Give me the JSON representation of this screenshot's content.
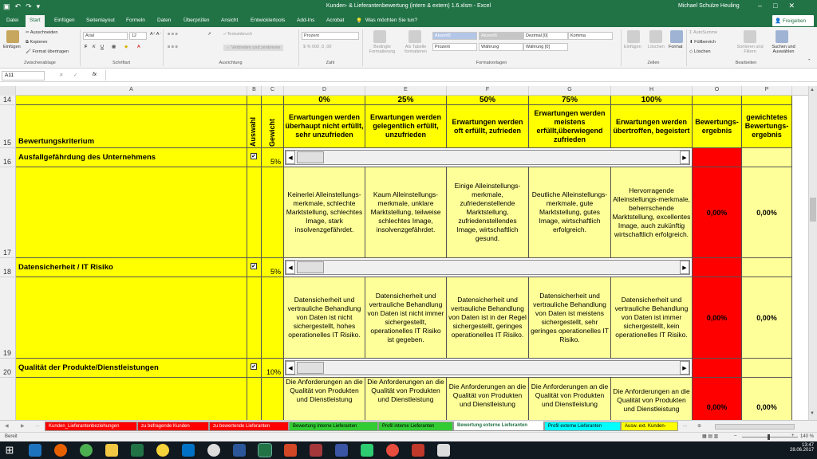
{
  "window": {
    "title": "Kunden- & Lieferantenbewertung (intern & extern) 1.6.xlsm  -  Excel",
    "user": "Michael Schulze Heuling"
  },
  "tabs": [
    "Datei",
    "Start",
    "Einfügen",
    "Seitenlayout",
    "Formeln",
    "Daten",
    "Überprüfen",
    "Ansicht",
    "Entwicklertools",
    "Add-Ins",
    "Acrobat"
  ],
  "tell_me": "Was möchten Sie tun?",
  "share_label": "Freigeben",
  "ribbon": {
    "clipboard": {
      "paste": "Einfügen",
      "cut": "Ausschneiden",
      "copy": "Kopieren",
      "format_painter": "Format übertragen",
      "group": "Zwischenablage"
    },
    "font": {
      "name": "Arial",
      "size": "12",
      "group": "Schriftart"
    },
    "alignment": {
      "wrap": "Textumbruch",
      "merge": "Verbinden und zentrieren",
      "group": "Ausrichtung"
    },
    "number": {
      "format": "Prozent",
      "group": "Zahl"
    },
    "styles": {
      "conditional": "Bedingte Formatierung",
      "as_table": "Als Tabelle formatieren",
      "style1": "Akzent5",
      "style2": "Akzent6",
      "style3": "Dezimal [0]",
      "style4": "Komma",
      "style5": "Prozent",
      "style6": "Währung",
      "style7": "Währung [0]",
      "group": "Formatvorlagen"
    },
    "cells": {
      "insert": "Einfügen",
      "delete": "Löschen",
      "format": "Format",
      "group": "Zellen"
    },
    "editing": {
      "autosum": "AutoSumme",
      "fill": "Füllbereich",
      "clear": "Löschen",
      "sort": "Sortieren und Filtern",
      "find": "Suchen und Auswählen",
      "group": "Bearbeiten"
    }
  },
  "formula_bar": {
    "name_box": "A11",
    "fx": "fx",
    "content": ""
  },
  "columns": [
    "A",
    "B",
    "C",
    "D",
    "E",
    "F",
    "G",
    "H",
    "O",
    "P"
  ],
  "header": {
    "row14": "14",
    "row15": "15",
    "pcts": [
      "0%",
      "25%",
      "50%",
      "75%",
      "100%"
    ],
    "criterion": "Bewertungskriterium",
    "auswahl": "Auswahl",
    "gewicht": "Gewicht",
    "levels": [
      "Erwartungen werden überhaupt nicht erfüllt, sehr unzufrieden",
      "Erwartungen werden gelegentlich erfüllt, unzufrieden",
      "Erwartungen werden oft erfüllt, zufrieden",
      "Erwartungen werden meistens erfüllt,überwiegend zufrieden",
      "Erwartungen werden übertroffen, begeistert"
    ],
    "score": "Bewertungs-ergebnis",
    "weighted": "gewichtetes Bewertungs-ergebnis"
  },
  "criteria": [
    {
      "row": "16",
      "desc_row": "17",
      "name": "Ausfallgefährdung des Unternehmens",
      "check": "✔",
      "weight": "5%",
      "descs": [
        "Keinerlei Alleinstellungs-merkmale, schlechte Marktstellung, schlechtes Image, stark insolvenzgefährdet.",
        "Kaum Alleinstellungs-merkmale, unklare Marktstellung, teilweise schlechtes Image, insolvenzgefährdet.",
        "Einige Alleinstellungs-merkmale, zufriedenstellende Marktstellung, zufriedenstellendes Image, wirtschaftlich gesund.",
        "Deutliche Alleinstellungs-merkmale, gute Marktstellung, gutes Image, wirtschaftlich erfolgreich.",
        "Hervorragende Alleinstellungs-merkmale, beherrschende Marktstellung, excellentes Image, auch zukünftig wirtschaftlich erfolgreich."
      ],
      "score": "0,00%",
      "weighted": "0,00%"
    },
    {
      "row": "18",
      "desc_row": "19",
      "name": "Datensicherheit / IT Risiko",
      "check": "✔",
      "weight": "5%",
      "descs": [
        "Datensicherheit und vertrauliche Behandlung von Daten ist nicht sichergestellt, hohes operationelles IT Risiko.",
        "Datensicherheit und vertrauliche Behandlung von Daten ist nicht immer sichergestellt, operationelles IT Risiko ist gegeben.",
        "Datensicherheit und vertrauliche Behandlung von Daten ist in der Regel sichergestellt, geringes operationelles IT Risiko.",
        "Datensicherheit und vertrauliche Behandlung von Daten ist meistens sichergestellt, sehr geringes operationelles IT Risiko.",
        "Datensicherheit und vertrauliche Behandlung von Daten ist immer sichergestellt, kein operationelles IT Risiko."
      ],
      "score": "0,00%",
      "weighted": "0,00%"
    },
    {
      "row": "20",
      "desc_row": "",
      "name": "Qualität der Produkte/Dienstleistungen",
      "check": "✔",
      "weight": "10%",
      "descs": [
        "Die Anforderungen an die Qualität von Produkten und Dienstleistung",
        "Die Anforderungen an die Qualität von Produkten und Dienstleistung",
        "Die Anforderungen an die Qualität von Produkten und Dienstleistung",
        "Die Anforderungen an die Qualität von Produkten und Dienstleistung",
        "Die Anforderungen an die Qualität von Produkten und Dienstleistung"
      ],
      "score": "0,00%",
      "weighted": "0,00%"
    }
  ],
  "sheets": [
    {
      "label": "Kunden_Lieferantenbeziehungen",
      "color": "#ff0000"
    },
    {
      "label": "zu befragende Kunden",
      "color": "#ff0000"
    },
    {
      "label": "zu bewertende Lieferanten",
      "color": "#ff0000"
    },
    {
      "label": "Bewertung interne Lieferanten",
      "color": "#33cc33"
    },
    {
      "label": "Profil interne Lieferanten",
      "color": "#33cc33"
    },
    {
      "label": "Bewertung externe Lieferanten",
      "color": "#ffffff"
    },
    {
      "label": "Profil externe Lieferanten",
      "color": "#00ffff"
    },
    {
      "label": "Ausw. ext. Kunden-",
      "color": "#ffff00"
    }
  ],
  "sheet_more": "...",
  "status": {
    "ready": "Bereit",
    "zoom": "140 %"
  },
  "taskbar": {
    "time": "13:47",
    "date": "28.06.2017"
  }
}
